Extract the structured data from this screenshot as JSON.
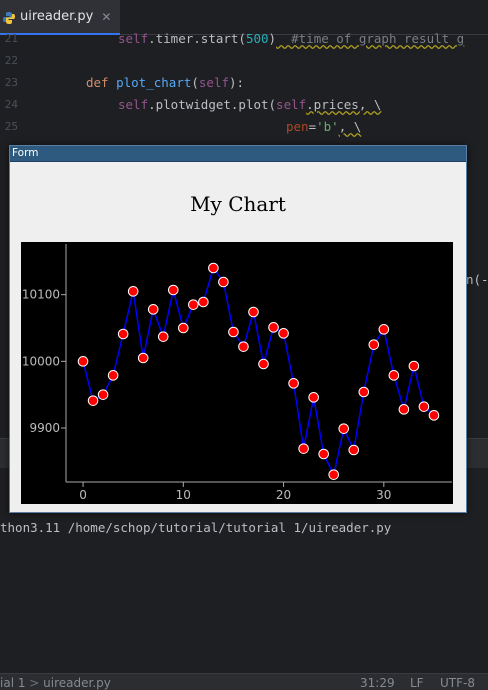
{
  "ide": {
    "tab": {
      "label": "uireader.py",
      "close": "✕"
    },
    "line_numbers": [
      "21",
      "22",
      "23",
      "24",
      "25"
    ],
    "code": {
      "line21": {
        "self": "self",
        "rest": ".timer.start(",
        "num": "500",
        "close": ")",
        "comment": "  #time of graph result g"
      },
      "line23": {
        "kw": "def ",
        "fn": "plot_chart",
        "open": "(",
        "self": "self",
        "close": "):"
      },
      "line24": {
        "self1": "self",
        "mid": ".plotwidget.plot(",
        "self2": "self",
        "rest": ".prices, \\"
      },
      "line25": {
        "param": "pen",
        "eq": "=",
        "str": "'b'",
        "rest": ", \\"
      }
    },
    "right_snippet": "n(-",
    "console_line": "thon3.11 /home/schop/tutorial/tutorial 1/uireader.py",
    "status": {
      "crumb1": "ial 1",
      "crumb_sep": " > ",
      "crumb2": "uireader.py",
      "position": "31:29",
      "line_ending": "LF",
      "encoding": "UTF-8"
    }
  },
  "form": {
    "window_title": "Form",
    "chart_title": "My Chart"
  },
  "chart_data": {
    "type": "line",
    "title": "My Chart",
    "xlabel": "",
    "ylabel": "",
    "x_ticks": [
      0,
      10,
      20,
      30
    ],
    "y_ticks": [
      9900,
      10000,
      10100
    ],
    "xlim": [
      -1.7,
      36.8
    ],
    "ylim": [
      9819,
      10176
    ],
    "line_color": "#0000ff",
    "marker_color": "#ff0000",
    "marker_edge": "#ffffff",
    "grid": false,
    "series": [
      {
        "x": [
          0,
          1,
          2,
          3,
          4,
          5,
          6,
          7,
          8,
          9,
          10,
          11,
          12,
          13,
          14,
          15,
          16,
          17,
          18,
          19,
          20,
          21,
          22,
          23,
          24,
          25,
          26,
          27,
          28,
          29,
          30,
          31,
          32,
          33,
          34,
          35
        ],
        "values": [
          10000,
          9941,
          9950,
          9979,
          10041,
          10105,
          10005,
          10078,
          10037,
          10107,
          10050,
          10085,
          10089,
          10140,
          10119,
          10044,
          10022,
          10074,
          9996,
          10051,
          10042,
          9967,
          9869,
          9946,
          9861,
          9830,
          9899,
          9867,
          9954,
          10025,
          10048,
          9979,
          9928,
          9993,
          9932,
          9919
        ]
      }
    ]
  }
}
